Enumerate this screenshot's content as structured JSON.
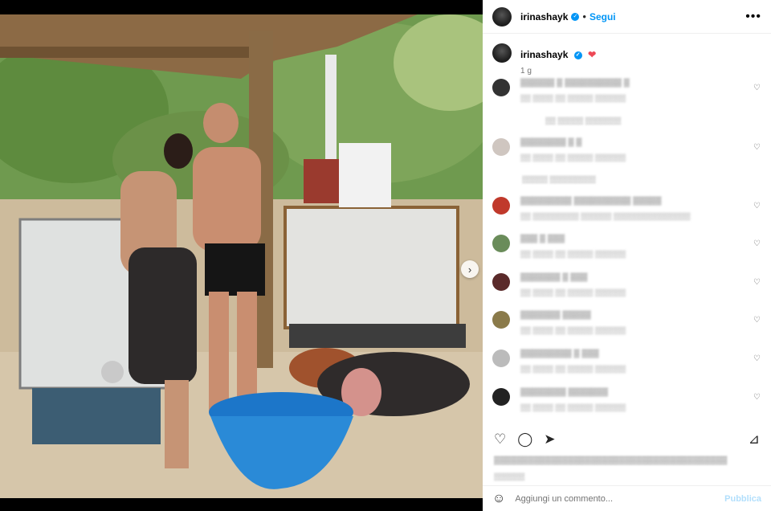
{
  "post": {
    "username": "irinashayk",
    "follow_label": "Segui",
    "more_label": "•••",
    "caption_username": "irinashayk",
    "caption_text": "❤",
    "caption_time": "1 g"
  },
  "comments": [
    {
      "name": "▒▒▒▒▒▒ ▒ ▒▒▒▒▒▒▒▒▒▒ ▒",
      "meta": "▒▒  ▒▒▒▒  ▒▒ ▒▒▒▒▒  ▒▒▒▒▒▒",
      "like": "♡",
      "color": "#333333"
    },
    {
      "name": "▒▒▒▒▒▒▒▒ ▒ ▒",
      "meta": "▒▒  ▒▒▒▒  ▒▒ ▒▒▒▒▒  ▒▒▒▒▒▒",
      "like": "♡",
      "color": "#cfc6c0"
    },
    {
      "name": "▒▒▒▒▒▒▒▒▒ ▒▒▒▒▒▒▒▒▒▒ ▒▒▒▒▒",
      "meta": "▒▒  ▒▒▒▒▒▒▒▒▒ ▒▒▒▒▒▒ ▒▒▒▒▒▒▒▒▒▒▒▒▒▒▒",
      "like": "♡",
      "color": "#c0392b"
    },
    {
      "name": "▒▒▒  ▒ ▒▒▒",
      "meta": "▒▒  ▒▒▒▒  ▒▒ ▒▒▒▒▒  ▒▒▒▒▒▒",
      "like": "♡",
      "color": "#6a8c5a"
    },
    {
      "name": "▒▒▒▒▒▒▒ ▒ ▒▒▒",
      "meta": "▒▒  ▒▒▒▒  ▒▒ ▒▒▒▒▒  ▒▒▒▒▒▒",
      "like": "♡",
      "color": "#5a2a2a"
    },
    {
      "name": "▒▒▒▒▒▒▒ ▒▒▒▒▒",
      "meta": "▒▒  ▒▒▒▒  ▒▒ ▒▒▒▒▒  ▒▒▒▒▒▒",
      "like": "♡",
      "color": "#8a7a4a"
    },
    {
      "name": "▒▒▒▒▒▒▒▒▒ ▒ ▒▒▒",
      "meta": "▒▒  ▒▒▒▒  ▒▒ ▒▒▒▒▒  ▒▒▒▒▒▒",
      "like": "♡",
      "color": "#bbbbbb"
    },
    {
      "name": "▒▒▒▒▒▒▒▒ ▒▒▒▒▒▒▒",
      "meta": "▒▒  ▒▒▒▒  ▒▒ ▒▒▒▒▒  ▒▒▒▒▒▒",
      "like": "♡",
      "color": "#222222"
    }
  ],
  "replies": [
    {
      "text": "▒▒ ▒▒▒▒▒ ▒▒▒▒▒▒▒"
    },
    {
      "text": "▒▒▒▒▒ ▒▒▒▒▒▒▒▒▒"
    }
  ],
  "actions": {
    "like_icon": "♡",
    "comment_icon": "◯",
    "share_icon": "➤",
    "save_icon": "⊿"
  },
  "likes_text": "▒▒▒▒▒▒▒▒▒▒▒▒▒▒▒▒▒▒▒▒▒▒▒▒▒▒▒▒▒▒▒▒▒▒▒▒▒▒▒▒▒",
  "date_text": "▒▒▒▒▒▒",
  "add_comment": {
    "placeholder": "Aggiungi un commento...",
    "publish_label": "Pubblica",
    "emoji_icon": "☺"
  },
  "carousel": {
    "next_label": "›",
    "page_count": 5,
    "active_index": 0
  }
}
